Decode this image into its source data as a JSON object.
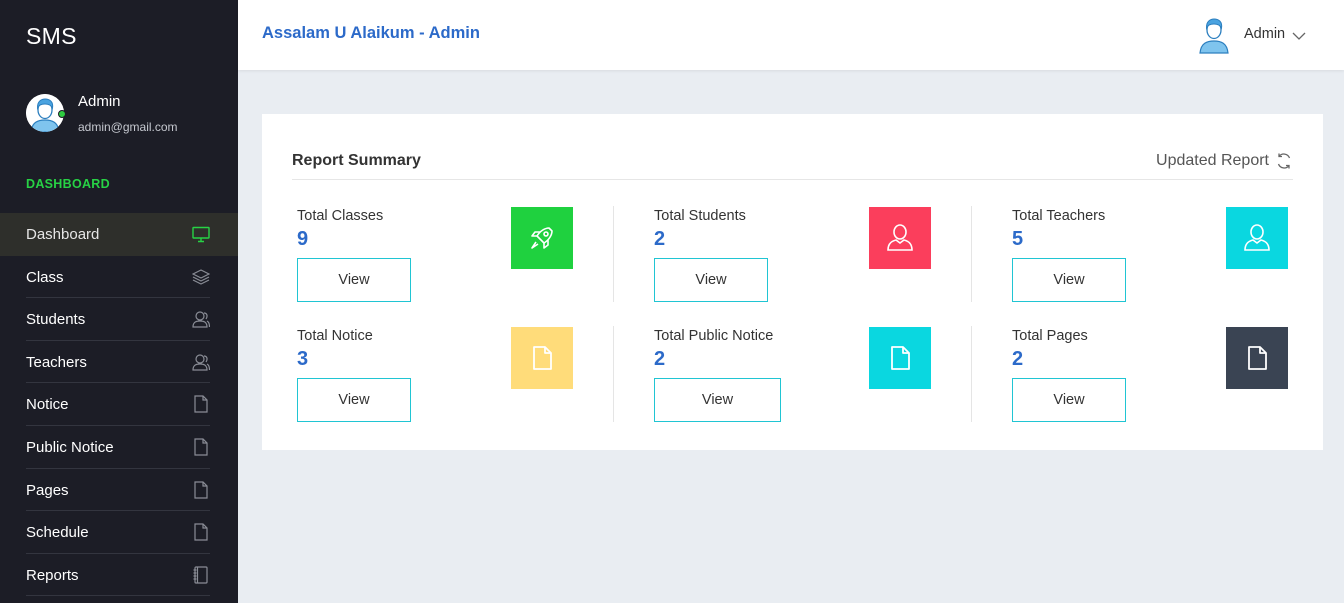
{
  "sidebar": {
    "brand": "SMS",
    "profile": {
      "name": "Admin",
      "email": "admin@gmail.com"
    },
    "section_label": "DASHBOARD",
    "items": [
      {
        "label": "Dashboard",
        "icon": "monitor-icon",
        "active": true
      },
      {
        "label": "Class",
        "icon": "layers-icon"
      },
      {
        "label": "Students",
        "icon": "users-icon"
      },
      {
        "label": "Teachers",
        "icon": "users-icon"
      },
      {
        "label": "Notice",
        "icon": "document-icon"
      },
      {
        "label": "Public Notice",
        "icon": "document-icon"
      },
      {
        "label": "Pages",
        "icon": "document-icon"
      },
      {
        "label": "Schedule",
        "icon": "document-icon"
      },
      {
        "label": "Reports",
        "icon": "notebook-icon"
      }
    ]
  },
  "topbar": {
    "greeting": "Assalam U Alaikum - Admin",
    "user": "Admin"
  },
  "report": {
    "title": "Report Summary",
    "updated": "Updated Report",
    "stats": [
      {
        "label": "Total Classes",
        "count": "9",
        "button": "View",
        "icon": "rocket-icon",
        "color": "#1fd13f"
      },
      {
        "label": "Total Students",
        "count": "2",
        "button": "View",
        "icon": "user-icon",
        "color": "#fb3e5c"
      },
      {
        "label": "Total Teachers",
        "count": "5",
        "button": "View",
        "icon": "user-icon",
        "color": "#0ad7e0"
      },
      {
        "label": "Total Notice",
        "count": "3",
        "button": "View",
        "icon": "document-icon",
        "color": "#ffdc7a"
      },
      {
        "label": "Total Public Notice",
        "count": "2",
        "button": "View",
        "icon": "document-icon",
        "color": "#0ad7e0"
      },
      {
        "label": "Total Pages",
        "count": "2",
        "button": "View",
        "icon": "document-icon",
        "color": "#3a4453"
      }
    ]
  },
  "colors": {
    "sidebar_bg": "#1c1d26",
    "accent_green": "#27d245",
    "primary_blue": "#2c6ac9",
    "button_border": "#20c5d3"
  }
}
